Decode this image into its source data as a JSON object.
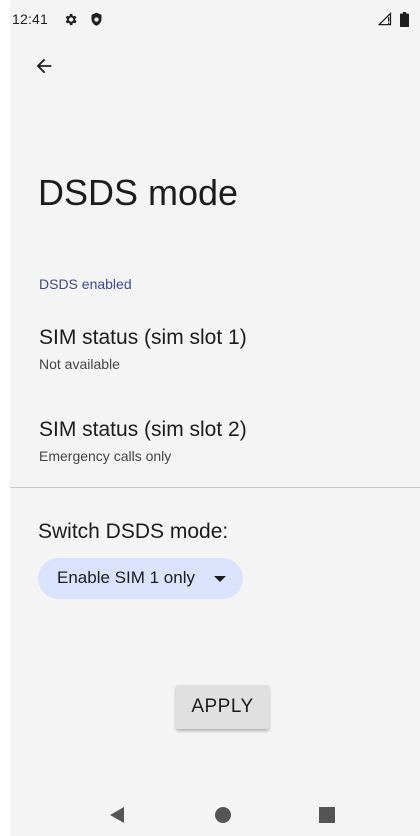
{
  "status_bar": {
    "time": "12:41",
    "icons": [
      "gear-icon",
      "shield-icon",
      "signal-icon",
      "battery-icon"
    ]
  },
  "toolbar": {
    "back_icon": "arrow-left-icon"
  },
  "page": {
    "title": "DSDS mode",
    "section_header": "DSDS enabled",
    "sim_slot_1": {
      "title": "SIM status (sim slot 1)",
      "summary": "Not available"
    },
    "sim_slot_2": {
      "title": "SIM status (sim slot 2)",
      "summary": "Emergency calls only"
    },
    "switch_label": "Switch DSDS mode:",
    "spinner_selected": "Enable SIM 1 only",
    "apply_label": "APPLY"
  },
  "nav_bar": {
    "icons": [
      "back-triangle-icon",
      "home-circle-icon",
      "recents-square-icon"
    ]
  },
  "colors": {
    "background": "#f4f4f4",
    "accent_text": "#3c4a8f",
    "spinner_bg": "#dbe3fc",
    "button_bg": "#e0e0e0"
  }
}
